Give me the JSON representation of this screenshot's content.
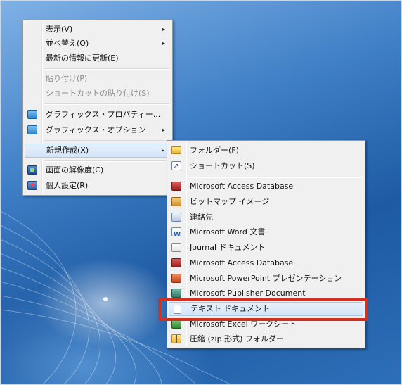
{
  "context_menu": {
    "items": [
      {
        "label": "表示(V)",
        "has_submenu": true,
        "enabled": true
      },
      {
        "label": "並べ替え(O)",
        "has_submenu": true,
        "enabled": true
      },
      {
        "label": "最新の情報に更新(E)",
        "has_submenu": false,
        "enabled": true
      },
      {
        "label": "貼り付け(P)",
        "has_submenu": false,
        "enabled": false
      },
      {
        "label": "ショートカットの貼り付け(S)",
        "has_submenu": false,
        "enabled": false
      },
      {
        "label": "グラフィックス・プロパティー...",
        "has_submenu": false,
        "enabled": true,
        "icon": "graphics-icon"
      },
      {
        "label": "グラフィックス・オプション",
        "has_submenu": true,
        "enabled": true,
        "icon": "graphics-icon"
      },
      {
        "label": "新規作成(X)",
        "has_submenu": true,
        "enabled": true,
        "highlighted": true
      },
      {
        "label": "画面の解像度(C)",
        "has_submenu": false,
        "enabled": true,
        "icon": "screen-resolution-icon"
      },
      {
        "label": "個人設定(R)",
        "has_submenu": false,
        "enabled": true,
        "icon": "personalize-icon"
      }
    ]
  },
  "new_submenu": {
    "items": [
      {
        "label": "フォルダー(F)",
        "icon": "folder-icon"
      },
      {
        "label": "ショートカット(S)",
        "icon": "shortcut-icon"
      },
      {
        "label": "Microsoft Access Database",
        "icon": "access-icon"
      },
      {
        "label": "ビットマップ イメージ",
        "icon": "bitmap-icon"
      },
      {
        "label": "連絡先",
        "icon": "contact-icon"
      },
      {
        "label": "Microsoft Word 文書",
        "icon": "word-icon"
      },
      {
        "label": "Journal ドキュメント",
        "icon": "journal-icon"
      },
      {
        "label": "Microsoft Access Database",
        "icon": "access-icon"
      },
      {
        "label": "Microsoft PowerPoint プレゼンテーション",
        "icon": "powerpoint-icon"
      },
      {
        "label": "Microsoft Publisher Document",
        "icon": "publisher-icon"
      },
      {
        "label": "テキスト ドキュメント",
        "icon": "text-document-icon",
        "highlighted": true
      },
      {
        "label": "Microsoft Excel ワークシート",
        "icon": "excel-icon"
      },
      {
        "label": "圧縮 (zip 形式) フォルダー",
        "icon": "zip-folder-icon"
      }
    ]
  },
  "submenu_arrow": "▸",
  "annotation": {
    "color": "#d2311f",
    "target": "テキスト ドキュメント"
  }
}
